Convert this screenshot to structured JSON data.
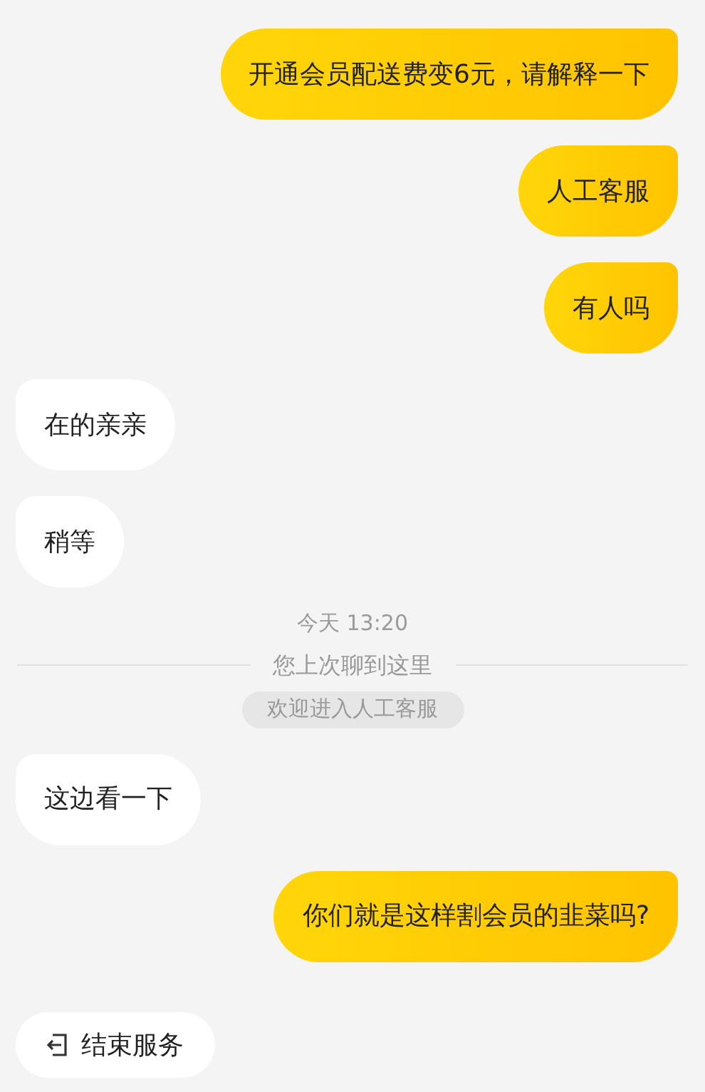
{
  "messages": [
    {
      "kind": "sent",
      "text": "开通会员配送费变6元，请解释一下"
    },
    {
      "kind": "sent",
      "text": "人工客服"
    },
    {
      "kind": "sent",
      "text": "有人吗"
    },
    {
      "kind": "received",
      "text": "在的亲亲"
    },
    {
      "kind": "received",
      "text": "稍等"
    },
    {
      "kind": "time",
      "text": "今天 13:20"
    },
    {
      "kind": "divider",
      "text": "您上次聊到这里"
    },
    {
      "kind": "notice",
      "text": "欢迎进入人工客服"
    },
    {
      "kind": "received",
      "text": "这边看一下"
    },
    {
      "kind": "sent",
      "text": "你们就是这样割会员的韭菜吗?"
    }
  ],
  "end_button": {
    "label": "结束服务"
  }
}
